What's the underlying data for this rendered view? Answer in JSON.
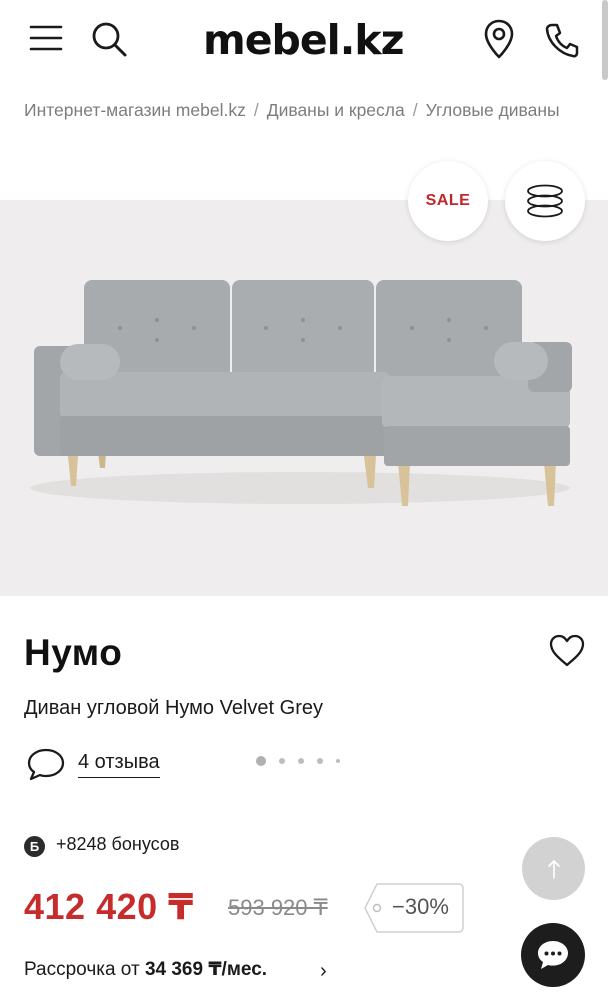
{
  "header": {
    "logo": "mebel.kz",
    "icons": [
      "menu-icon",
      "search-icon",
      "location-pin-icon",
      "phone-icon"
    ]
  },
  "breadcrumb": {
    "items": [
      "Интернет-магазин mebel.kz",
      "Диваны и кресла",
      "Угловые диваны"
    ],
    "separator": "/"
  },
  "gallery": {
    "sale_badge": "SALE",
    "view_3d_icon": "stack-3d-icon",
    "slide_count": 5,
    "active_slide": 1
  },
  "product": {
    "title": "Нумо",
    "subtitle": "Диван угловой Нумо Velvet Grey",
    "reviews": "4 отзыва",
    "bonus_badge": "Б",
    "bonus_text": "+8248 бонусов",
    "price": "412 420 ₸",
    "old_price": "593 920 ₸",
    "discount": "−30%",
    "installment_prefix": "Рассрочка от",
    "installment_amount": "34 369 ₸/мес.",
    "installment_arrow": "›"
  },
  "colors": {
    "price_red": "#c62c2c",
    "sale_red": "#c0262c",
    "gallery_bg": "#efeded",
    "chat_button": "#1d1d1d",
    "scroll_top_button": "#d2d2d2"
  }
}
